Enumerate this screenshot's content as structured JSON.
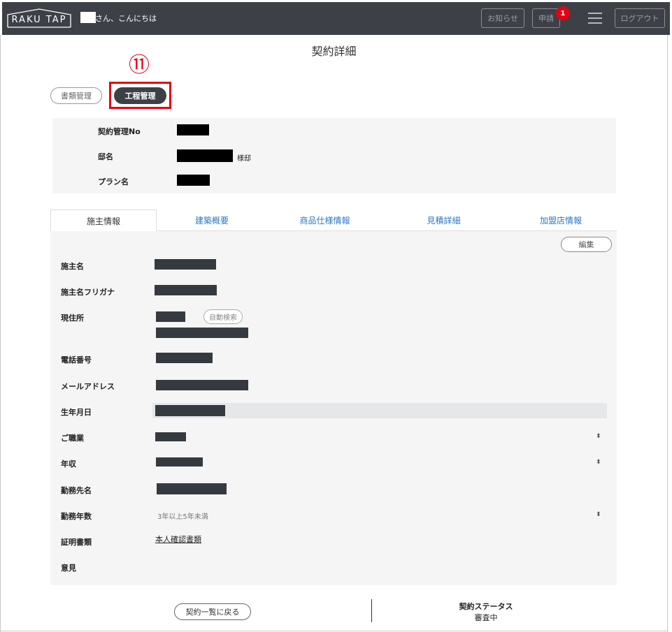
{
  "header": {
    "logo_text": "RAKU TAP",
    "greeting": "さん、こんにちは",
    "notice_label": "お知らせ",
    "apply_label": "申請",
    "apply_badge": "1",
    "logout_label": "ログアウト"
  },
  "page_title": "契約詳細",
  "annotation": {
    "number": "⑪"
  },
  "nav_pills": {
    "docs_label": "書類管理",
    "process_label": "工程管理"
  },
  "summary": {
    "contract_no_label": "契約管理No",
    "house_name_label": "邸名",
    "house_suffix": "様邸",
    "plan_label": "プラン名"
  },
  "tabs": [
    "施主情報",
    "建築概要",
    "商品仕様情報",
    "見積詳細",
    "加盟店情報"
  ],
  "details": {
    "edit_label": "編集",
    "auto_search_label": "自動検索",
    "fields": {
      "owner_name": "施主名",
      "owner_kana": "施主名フリガナ",
      "address": "現住所",
      "phone": "電話番号",
      "email": "メールアドレス",
      "birthdate": "生年月日",
      "occupation": "ご職業",
      "income": "年収",
      "employer": "勤務先名",
      "years_employed": "勤務年数",
      "certificate": "証明書類",
      "opinion": "意見"
    },
    "years_employed_value": "3年以上5年未満",
    "certificate_value": "本人確認書類"
  },
  "footer": {
    "back_label": "契約一覧に戻る",
    "status_label": "契約ステータス",
    "status_value": "審査中"
  },
  "colors": {
    "header_bg": "#3d4147",
    "accent_red": "#e60012",
    "link_blue": "#2a78c4"
  }
}
